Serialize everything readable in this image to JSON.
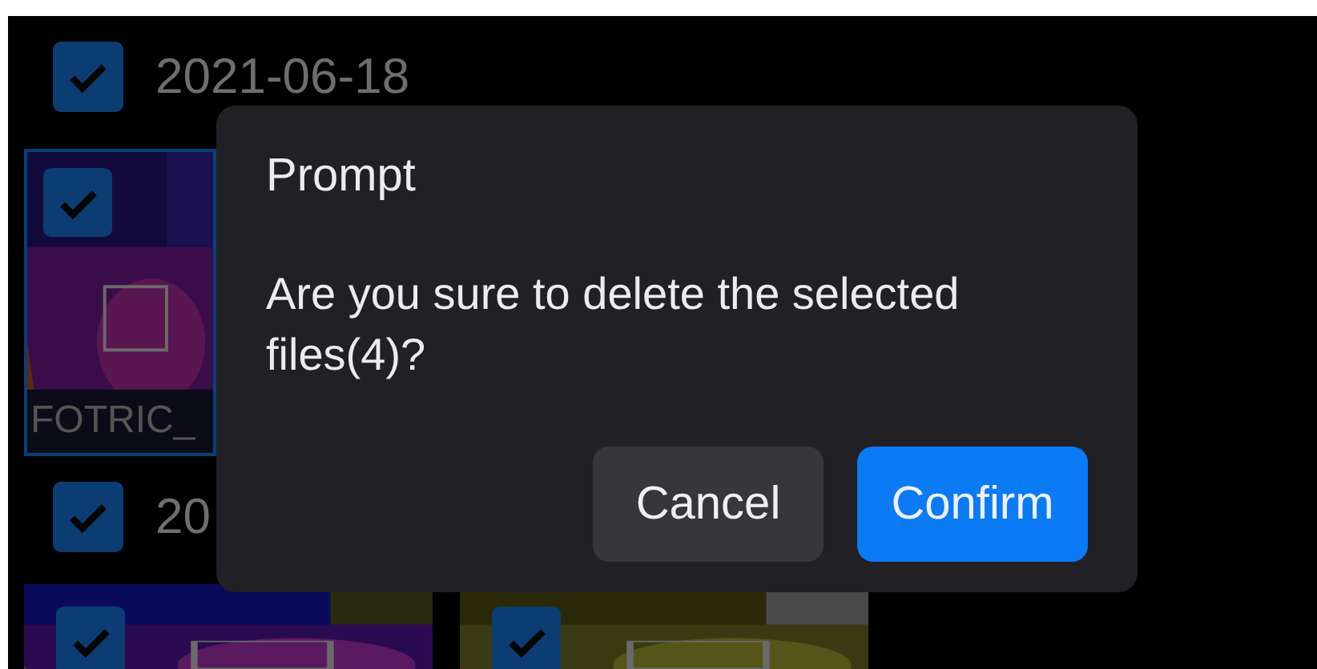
{
  "date_groups": [
    {
      "date": "2021-06-18",
      "checked": true,
      "files": [
        {
          "kind": "picture",
          "name": "FOTRIC_",
          "checked": true
        }
      ]
    },
    {
      "date": "20",
      "checked": true,
      "files": [
        {
          "kind": "picture",
          "checked": true
        },
        {
          "kind": "picture",
          "checked": true
        }
      ]
    }
  ],
  "dialog": {
    "title": "Prompt",
    "message": "Are you sure to delete the selected files(4)?",
    "buttons": [
      {
        "label": "Cancel",
        "kind": "secondary"
      },
      {
        "label": "Confirm",
        "kind": "primary"
      }
    ]
  }
}
